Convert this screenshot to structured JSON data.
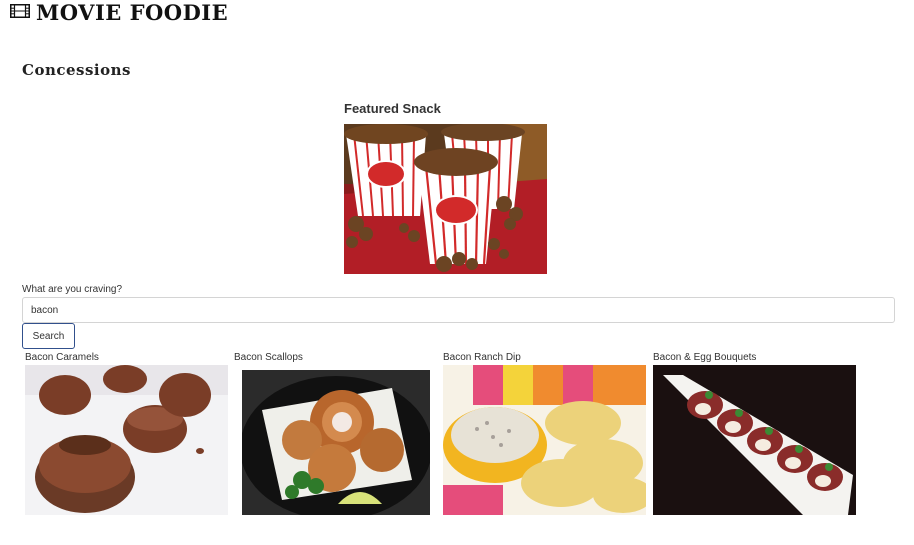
{
  "app": {
    "title": "MOVIE FOODIE",
    "icon": "film-icon"
  },
  "page": {
    "section_title": "Concessions"
  },
  "featured": {
    "label": "Featured Snack",
    "image_subject": "popcorn-boxes"
  },
  "search": {
    "label": "What are you craving?",
    "value": "bacon",
    "button_label": "Search"
  },
  "results": [
    {
      "title": "Bacon Caramels"
    },
    {
      "title": "Bacon Scallops"
    },
    {
      "title": "Bacon Ranch Dip"
    },
    {
      "title": "Bacon & Egg Bouquets"
    }
  ],
  "colors": {
    "button_border": "#31508c",
    "popcorn_red": "#c0202a"
  }
}
